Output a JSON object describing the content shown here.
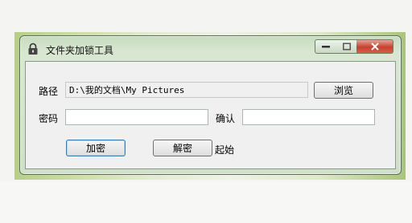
{
  "window": {
    "title": "文件夹加锁工具"
  },
  "path": {
    "label": "路径",
    "value": "D:\\我的文档\\My Pictures",
    "browse_label": "浏览"
  },
  "password": {
    "label": "密码",
    "value": "",
    "confirm_label": "确认",
    "confirm_value": ""
  },
  "actions": {
    "encrypt_label": "加密",
    "decrypt_label": "解密",
    "status_text": "起始"
  },
  "colors": {
    "title_bar": "#d0e0c8",
    "close_button": "#c4422f",
    "client_bg": "#f0f0f0"
  }
}
